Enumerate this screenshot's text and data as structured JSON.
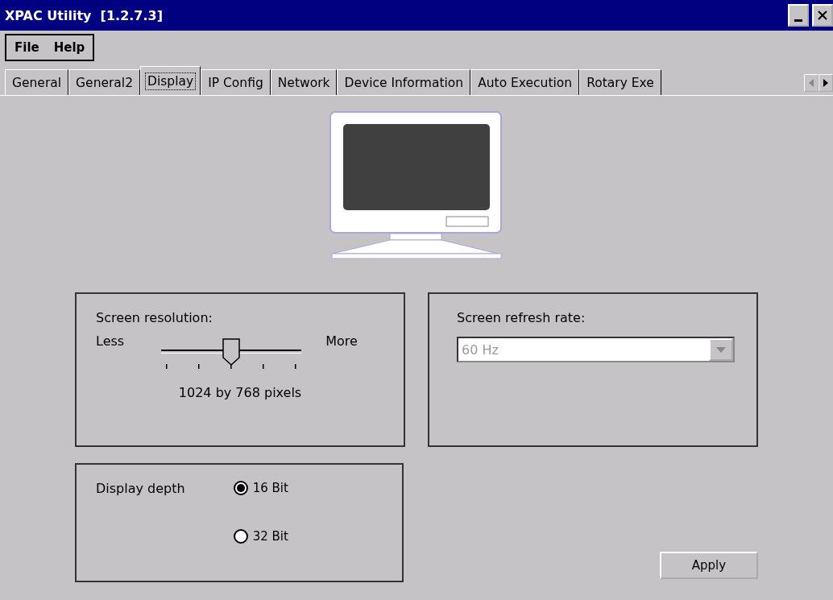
{
  "window": {
    "title": "XPAC Utility  [1.2.7.3]"
  },
  "menu": [
    "File",
    "Help"
  ],
  "tabs": [
    {
      "label": "General",
      "selected": false
    },
    {
      "label": "General2",
      "selected": false
    },
    {
      "label": "Display",
      "selected": true
    },
    {
      "label": "IP Config",
      "selected": false
    },
    {
      "label": "Network",
      "selected": false
    },
    {
      "label": "Device Information",
      "selected": false
    },
    {
      "label": "Auto Execution",
      "selected": false
    },
    {
      "label": "Rotary Exe",
      "selected": false
    }
  ],
  "resolution": {
    "title": "Screen resolution:",
    "less": "Less",
    "more": "More",
    "level": 0.5,
    "reading": "1024 by 768 pixels"
  },
  "refresh": {
    "title": "Screen refresh rate:",
    "value": "60 Hz",
    "disabled": true
  },
  "depth": {
    "title": "Display depth",
    "options": [
      {
        "label": "16 Bit",
        "selected": true
      },
      {
        "label": "32 Bit",
        "selected": false
      }
    ]
  },
  "apply_button": "Apply"
}
